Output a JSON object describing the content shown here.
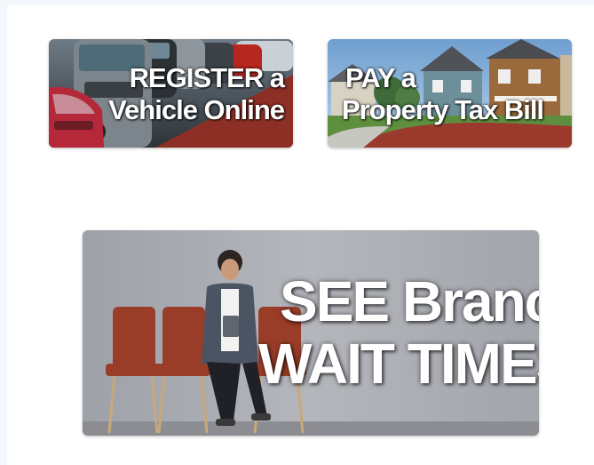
{
  "tiles": {
    "register": {
      "line1": "REGISTER a",
      "line2": "Vehicle Online",
      "image_icon": "cars-parking-lot-image"
    },
    "pay": {
      "line1": "PAY a",
      "line2": "Property Tax Bill",
      "image_icon": "houses-street-image"
    },
    "wait": {
      "line1": "SEE Branch",
      "line2": "WAIT TIMES",
      "image_icon": "person-waiting-chairs-image"
    }
  },
  "colors": {
    "page_bg": "#f3f7fb",
    "panel_bg": "#ffffff",
    "tile_text": "#ffffff",
    "wait_wall": "#a9abb3",
    "chair": "#9a3d28"
  }
}
